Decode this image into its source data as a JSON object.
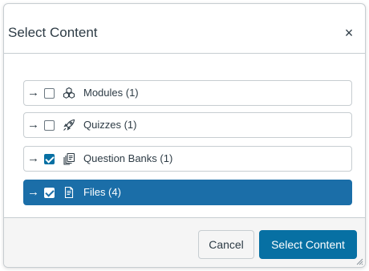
{
  "dialog": {
    "title": "Select Content",
    "close_label": "×"
  },
  "items": [
    {
      "arrow": "→",
      "label": "Modules (1)",
      "checked": false,
      "selected": false,
      "icon": "modules-icon"
    },
    {
      "arrow": "→",
      "label": "Quizzes (1)",
      "checked": false,
      "selected": false,
      "icon": "quizzes-icon"
    },
    {
      "arrow": "→",
      "label": "Question Banks (1)",
      "checked": true,
      "selected": false,
      "icon": "question-banks-icon"
    },
    {
      "arrow": "→",
      "label": "Files (4)",
      "checked": true,
      "selected": true,
      "icon": "files-icon"
    }
  ],
  "footer": {
    "cancel_label": "Cancel",
    "select_label": "Select Content"
  },
  "colors": {
    "accent": "#0770a3",
    "selected_row": "#1b6ea8",
    "border": "#c7cdd1",
    "footer_bg": "#f5f5f5",
    "text": "#2d3b45"
  }
}
